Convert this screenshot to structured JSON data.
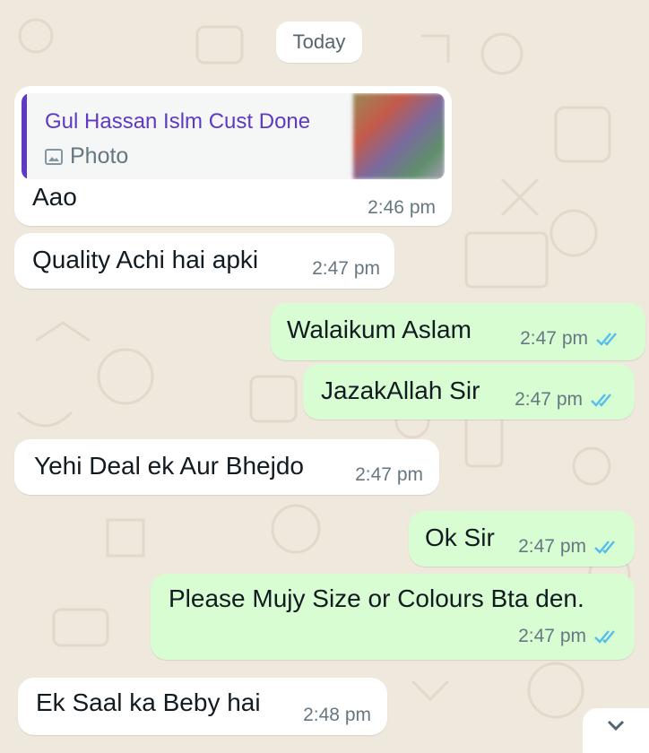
{
  "date_divider": "Today",
  "messages": [
    {
      "direction": "in",
      "quote": {
        "name": "Gul Hassan Islm Cust Done",
        "type": "Photo"
      },
      "text": "Aao",
      "time": "2:46 pm"
    },
    {
      "direction": "in",
      "text": "Quality Achi hai apki",
      "time": "2:47 pm"
    },
    {
      "direction": "out",
      "text": "Walaikum Aslam",
      "time": "2:47 pm",
      "status": "read"
    },
    {
      "direction": "out",
      "text": "JazakAllah Sir",
      "time": "2:47 pm",
      "status": "read"
    },
    {
      "direction": "in",
      "text": "Yehi Deal ek Aur Bhejdo",
      "time": "2:47 pm"
    },
    {
      "direction": "out",
      "text": "Ok Sir",
      "time": "2:47 pm",
      "status": "read"
    },
    {
      "direction": "out",
      "text": "Please Mujy Size or Colours Bta den.",
      "time": "2:47 pm",
      "status": "read"
    },
    {
      "direction": "in",
      "text": "Ek Saal ka Beby hai",
      "time": "2:48 pm"
    }
  ],
  "colors": {
    "background": "#efe8dc",
    "incoming_bubble": "#ffffff",
    "outgoing_bubble": "#d9fdd3",
    "read_ticks": "#53bdeb",
    "quote_accent": "#5e39c4"
  },
  "icons": {
    "read_receipt": "double-check-icon",
    "photo": "image-icon",
    "scroll": "chevron-down-icon"
  }
}
